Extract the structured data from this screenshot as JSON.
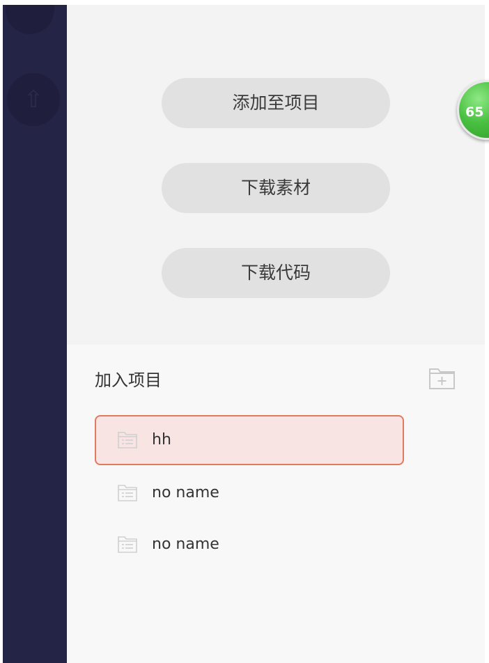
{
  "sidebar": {
    "icon_glyph": "⇧"
  },
  "actions": {
    "add_to_project": "添加至项目",
    "download_material": "下载素材",
    "download_code": "下载代码"
  },
  "score_badge": {
    "value": "65",
    "color": "#49c040"
  },
  "join_project": {
    "title": "加入项目",
    "new_folder_icon": "folder-plus-icon",
    "items": [
      {
        "name": "hh",
        "selected": true
      },
      {
        "name": "no name",
        "selected": false
      },
      {
        "name": "no name",
        "selected": false
      }
    ]
  },
  "colors": {
    "sidebar": "#242446",
    "selected_border": "#e07a5f",
    "selected_bg": "#f8e5e3"
  }
}
